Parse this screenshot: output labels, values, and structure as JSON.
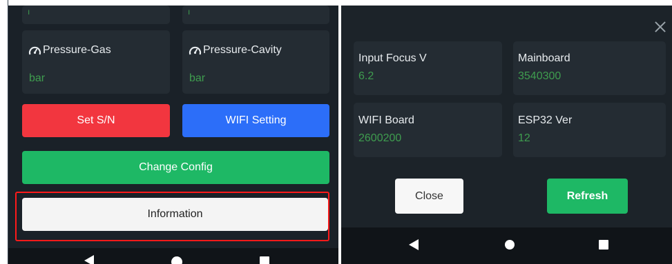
{
  "left": {
    "tiles": [
      {
        "title": "Pressure-Gas",
        "unit": "bar",
        "icon": "gauge-icon"
      },
      {
        "title": "Pressure-Cavity",
        "unit": "bar",
        "icon": "gauge-icon"
      }
    ],
    "buttons": {
      "set_sn": "Set S/N",
      "wifi_setting": "WIFI Setting",
      "change_config": "Change Config",
      "information": "Information"
    }
  },
  "right": {
    "tiles": [
      {
        "title": "Input Focus V",
        "value": "6.2"
      },
      {
        "title": "Mainboard",
        "value": "3540300"
      },
      {
        "title": "WIFI Board",
        "value": "2600200"
      },
      {
        "title": "ESP32 Ver",
        "value": "12"
      }
    ],
    "buttons": {
      "close": "Close",
      "refresh": "Refresh"
    }
  },
  "nav": {
    "icons": [
      "back-icon",
      "home-icon",
      "recents-icon"
    ]
  },
  "colors": {
    "accent_green": "#1eb865",
    "danger_red": "#f2363f",
    "primary_blue": "#2c6ef9",
    "value_green": "#3f9d4f",
    "highlight_red": "#ff1a1a"
  }
}
